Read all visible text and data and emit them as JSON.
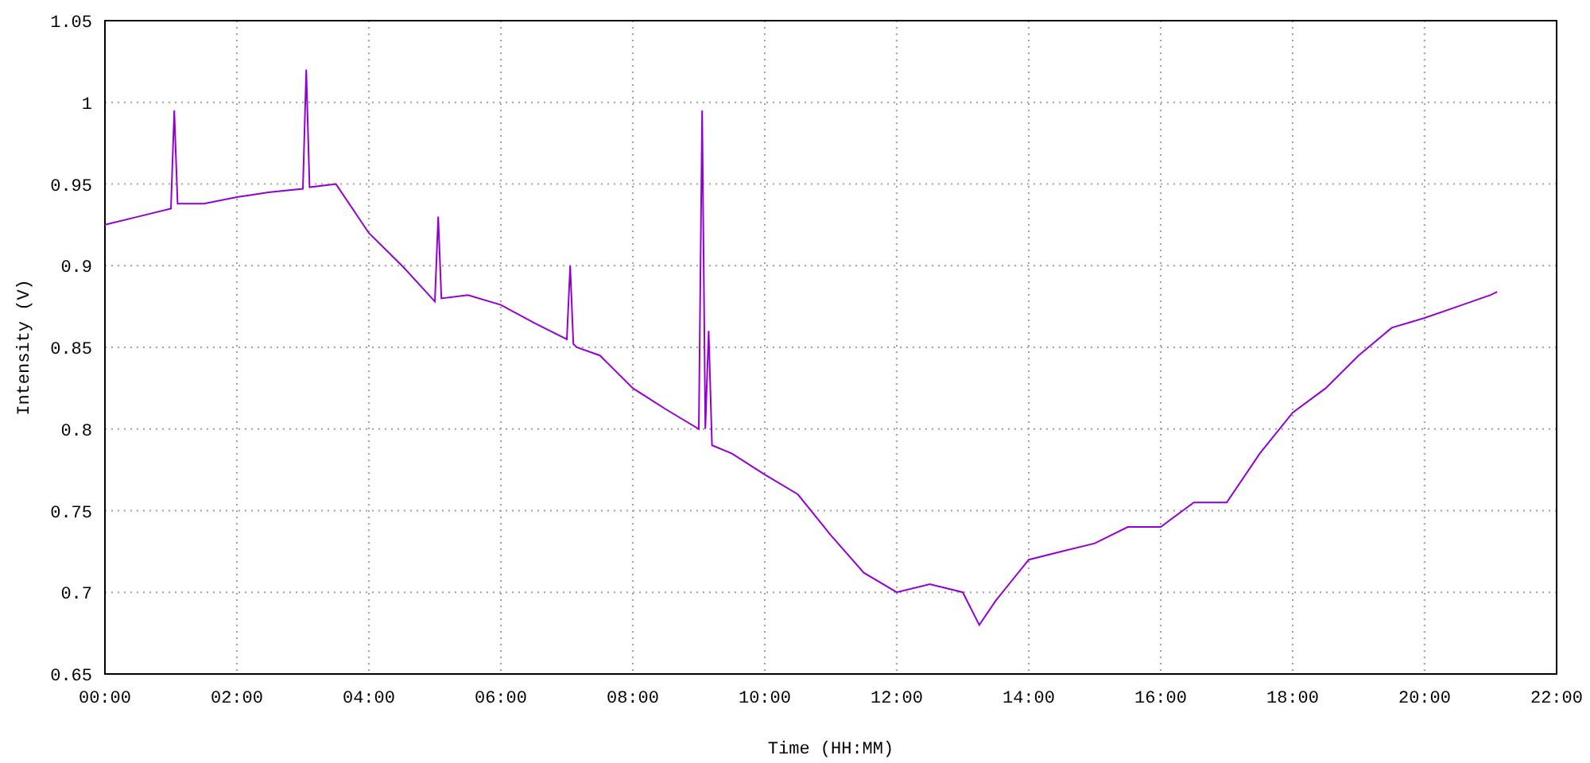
{
  "chart_data": {
    "type": "line",
    "xlabel": "Time (HH:MM)",
    "ylabel": "Intensity (V)",
    "grid": true,
    "xlim": [
      0,
      22
    ],
    "ylim": [
      0.65,
      1.05
    ],
    "xticks": [
      {
        "value": 0,
        "label": "00:00"
      },
      {
        "value": 2,
        "label": "02:00"
      },
      {
        "value": 4,
        "label": "04:00"
      },
      {
        "value": 6,
        "label": "06:00"
      },
      {
        "value": 8,
        "label": "08:00"
      },
      {
        "value": 10,
        "label": "10:00"
      },
      {
        "value": 12,
        "label": "12:00"
      },
      {
        "value": 14,
        "label": "14:00"
      },
      {
        "value": 16,
        "label": "16:00"
      },
      {
        "value": 18,
        "label": "18:00"
      },
      {
        "value": 20,
        "label": "20:00"
      },
      {
        "value": 22,
        "label": "22:00"
      }
    ],
    "yticks": [
      {
        "value": 0.65,
        "label": "0.65"
      },
      {
        "value": 0.7,
        "label": "0.7"
      },
      {
        "value": 0.75,
        "label": "0.75"
      },
      {
        "value": 0.8,
        "label": "0.8"
      },
      {
        "value": 0.85,
        "label": "0.85"
      },
      {
        "value": 0.9,
        "label": "0.9"
      },
      {
        "value": 0.95,
        "label": "0.95"
      },
      {
        "value": 1,
        "label": "1"
      },
      {
        "value": 1.05,
        "label": "1.05"
      }
    ],
    "x": [
      0,
      0.5,
      1,
      1.05,
      1.1,
      1.5,
      2,
      2.5,
      3,
      3.05,
      3.1,
      3.5,
      4,
      4.5,
      5,
      5.05,
      5.1,
      5.5,
      6,
      6.5,
      7,
      7.05,
      7.1,
      7.15,
      7.5,
      8,
      8.5,
      9,
      9.05,
      9.1,
      9.15,
      9.2,
      9.5,
      10,
      10.5,
      11,
      11.5,
      12,
      12.5,
      13,
      13.25,
      13.5,
      14,
      14.5,
      15,
      15.5,
      16,
      16.5,
      17,
      17.5,
      18,
      18.5,
      19,
      19.5,
      20,
      20.5,
      21,
      21.1
    ],
    "series": [
      {
        "color": "#9400d3",
        "values": [
          0.925,
          0.93,
          0.935,
          0.995,
          0.938,
          0.938,
          0.942,
          0.945,
          0.947,
          1.02,
          0.948,
          0.95,
          0.92,
          0.9,
          0.878,
          0.93,
          0.88,
          0.882,
          0.876,
          0.865,
          0.855,
          0.9,
          0.852,
          0.85,
          0.845,
          0.825,
          0.812,
          0.8,
          0.995,
          0.8,
          0.86,
          0.79,
          0.785,
          0.772,
          0.76,
          0.735,
          0.712,
          0.7,
          0.705,
          0.7,
          0.68,
          0.695,
          0.72,
          0.725,
          0.73,
          0.74,
          0.74,
          0.755,
          0.755,
          0.785,
          0.81,
          0.825,
          0.845,
          0.862,
          0.868,
          0.875,
          0.882,
          0.884
        ]
      }
    ]
  }
}
